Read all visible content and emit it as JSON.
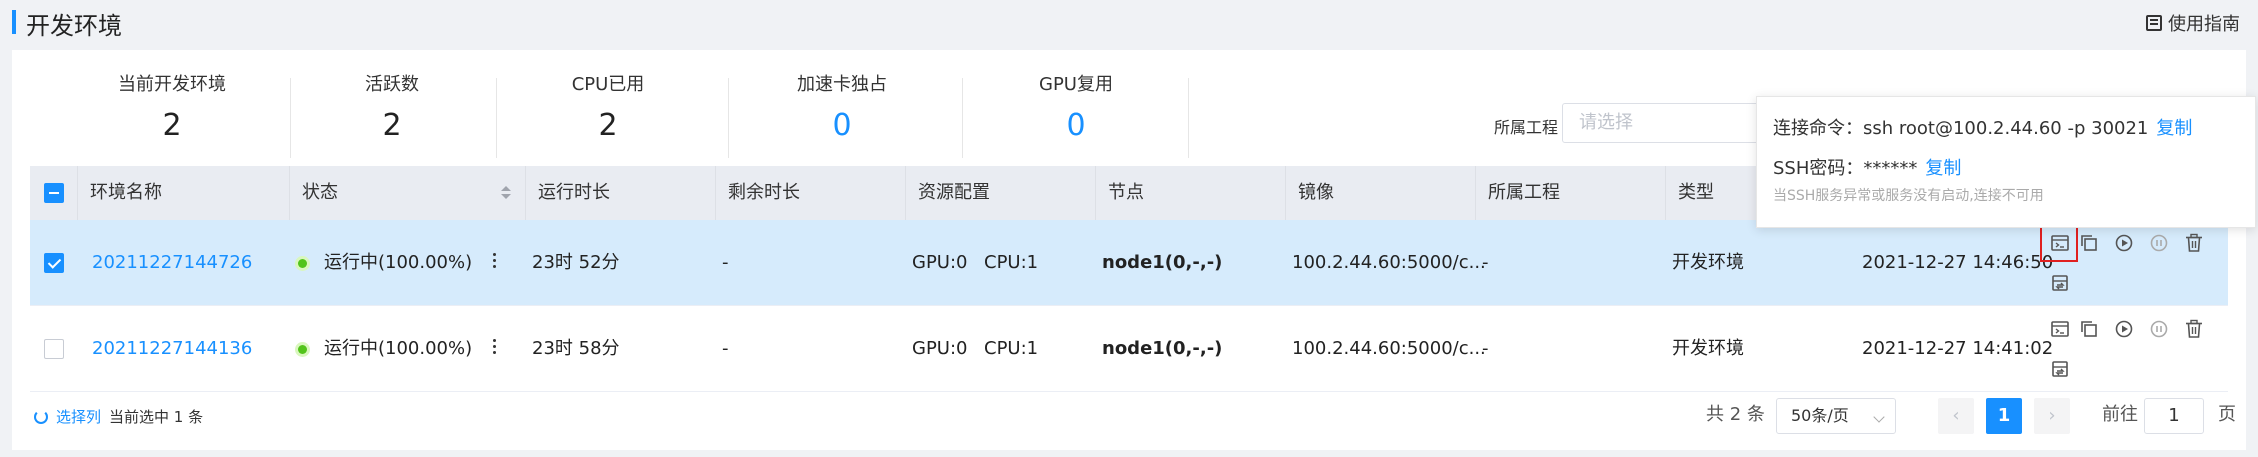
{
  "header": {
    "title": "开发环境",
    "guide_label": "使用指南"
  },
  "stats": [
    {
      "label": "当前开发环境",
      "value": "2",
      "highlight": false
    },
    {
      "label": "活跃数",
      "value": "2",
      "highlight": false
    },
    {
      "label": "CPU已用",
      "value": "2",
      "highlight": false
    },
    {
      "label": "加速卡独占",
      "value": "0",
      "highlight": true
    },
    {
      "label": "GPU复用",
      "value": "0",
      "highlight": true
    }
  ],
  "filter": {
    "label": "所属工程",
    "placeholder": "请选择"
  },
  "table": {
    "columns": [
      "环境名称",
      "状态",
      "运行时长",
      "剩余时长",
      "资源配置",
      "节点",
      "镜像",
      "所属工程",
      "类型"
    ],
    "rows": [
      {
        "selected": true,
        "name": "20211227144726",
        "status": "运行中(100.00%)",
        "runtime": "23时 52分",
        "remaining": "-",
        "gpu": "GPU:0",
        "cpu": "CPU:1",
        "node": "node1(0,-,-)",
        "image": "100.2.44.60:5000/c...",
        "project": "-",
        "type": "开发环境",
        "created": "2021-12-27 14:46:50"
      },
      {
        "selected": false,
        "name": "20211227144136",
        "status": "运行中(100.00%)",
        "runtime": "23时 58分",
        "remaining": "-",
        "gpu": "GPU:0",
        "cpu": "CPU:1",
        "node": "node1(0,-,-)",
        "image": "100.2.44.60:5000/c...",
        "project": "-",
        "type": "开发环境",
        "created": "2021-12-27 14:41:02"
      }
    ]
  },
  "tooltip": {
    "command_label": "连接命令：ssh root@100.2.44.60 -p 30021",
    "command_copy": "复制",
    "password_label": "SSH密码：******",
    "password_copy": "复制",
    "note": "当SSH服务异常或服务没有启动,连接不可用"
  },
  "footer": {
    "select_columns": "选择列",
    "current_selected": "当前选中 1 条",
    "total": "共 2 条",
    "page_size": "50条/页",
    "current_page": "1",
    "goto_label": "前往",
    "goto_value": "1",
    "page_unit": "页"
  },
  "colors": {
    "accent": "#1890ff",
    "selected_row": "#d6ebfc",
    "running": "#52c41a",
    "highlight_box": "#e02020"
  }
}
